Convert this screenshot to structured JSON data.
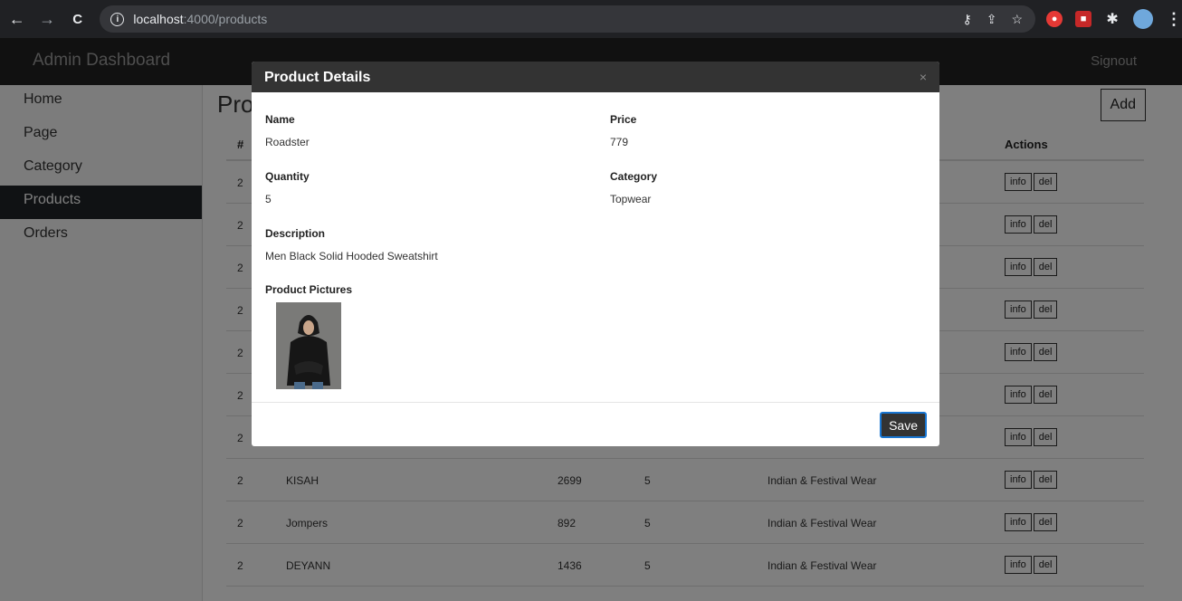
{
  "browser": {
    "url_host": "localhost",
    "url_path": ":4000/products"
  },
  "header": {
    "brand": "Admin Dashboard",
    "signout": "Signout"
  },
  "sidebar": {
    "items": [
      {
        "label": "Home"
      },
      {
        "label": "Page"
      },
      {
        "label": "Category"
      },
      {
        "label": "Products",
        "active": true
      },
      {
        "label": "Orders"
      }
    ]
  },
  "main": {
    "title": "Products",
    "add_label": "Add",
    "table": {
      "headers": {
        "hash": "#",
        "actions": "Actions"
      },
      "rows": [
        {
          "id": "2"
        },
        {
          "id": "2"
        },
        {
          "id": "2"
        },
        {
          "id": "2"
        },
        {
          "id": "2"
        },
        {
          "id": "2"
        },
        {
          "id": "2"
        },
        {
          "id": "2",
          "name": "KISAH",
          "price": "2699",
          "qty": "5",
          "category": "Indian & Festival Wear"
        },
        {
          "id": "2",
          "name": "Jompers",
          "price": "892",
          "qty": "5",
          "category": "Indian & Festival Wear"
        },
        {
          "id": "2",
          "name": "DEYANN",
          "price": "1436",
          "qty": "5",
          "category": "Indian & Festival Wear"
        }
      ],
      "info_label": "info",
      "del_label": "del"
    }
  },
  "modal": {
    "title": "Product Details",
    "close": "×",
    "fields": {
      "name_label": "Name",
      "name_value": "Roadster",
      "price_label": "Price",
      "price_value": "779",
      "quantity_label": "Quantity",
      "quantity_value": "5",
      "category_label": "Category",
      "category_value": "Topwear",
      "description_label": "Description",
      "description_value": "Men Black Solid Hooded Sweatshirt",
      "pictures_label": "Product Pictures"
    },
    "save_label": "Save"
  }
}
